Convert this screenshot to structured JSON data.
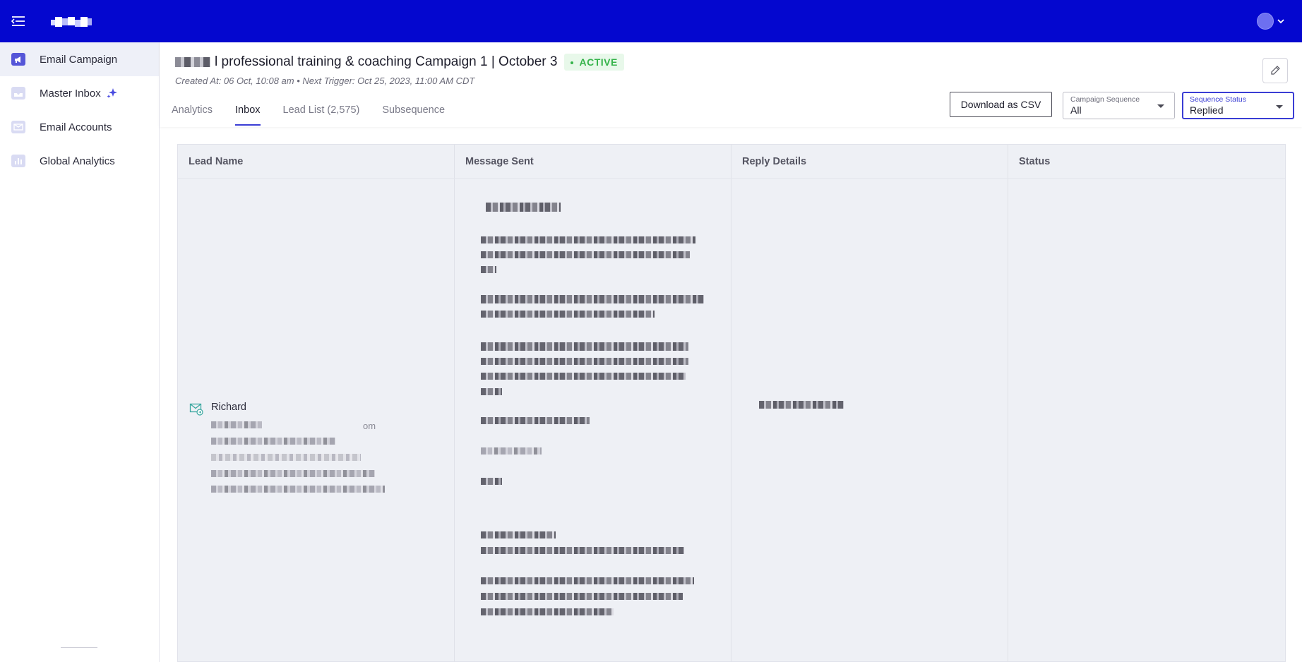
{
  "colors": {
    "topbar": "#0407cf",
    "accent": "#3a3dd4",
    "active_badge_bg": "#e8f8ea",
    "active_badge_text": "#35b34a",
    "table_bg": "#eef0f5"
  },
  "topbar": {
    "menu_icon": "hamburger-menu-icon",
    "logo": "brand-logo",
    "avatar_icon": "user-avatar-icon"
  },
  "sidebar": {
    "items": [
      {
        "label": "Email Campaign",
        "icon": "megaphone-icon",
        "active": true
      },
      {
        "label": "Master Inbox",
        "icon": "inbox-icon",
        "active": false,
        "badge_icon": "sparkle-icon"
      },
      {
        "label": "Email Accounts",
        "icon": "mail-accounts-icon",
        "active": false
      },
      {
        "label": "Global Analytics",
        "icon": "bar-chart-icon",
        "active": false
      }
    ]
  },
  "header": {
    "title": "l professional training & coaching Campaign 1 | October 3",
    "status": "ACTIVE",
    "meta": "Created At: 06 Oct, 10:08 am • Next Trigger: Oct 25, 2023, 11:00 AM CDT",
    "edit_icon": "pencil-icon"
  },
  "tabs": [
    {
      "label": "Analytics",
      "active": false
    },
    {
      "label": "Inbox",
      "active": true
    },
    {
      "label": "Lead List (2,575)",
      "active": false
    },
    {
      "label": "Subsequence",
      "active": false
    }
  ],
  "toolbar": {
    "download_label": "Download as CSV",
    "campaign_sequence": {
      "label": "Campaign Sequence",
      "value": "All"
    },
    "sequence_status": {
      "label": "Sequence Status",
      "value": "Replied"
    }
  },
  "table": {
    "columns": [
      "Lead Name",
      "Message Sent",
      "Reply Details",
      "Status"
    ],
    "rows": [
      {
        "lead_name": "Richard",
        "lead_icon": "email-reply-icon",
        "lead_details_partial": "om",
        "status": ""
      }
    ]
  }
}
